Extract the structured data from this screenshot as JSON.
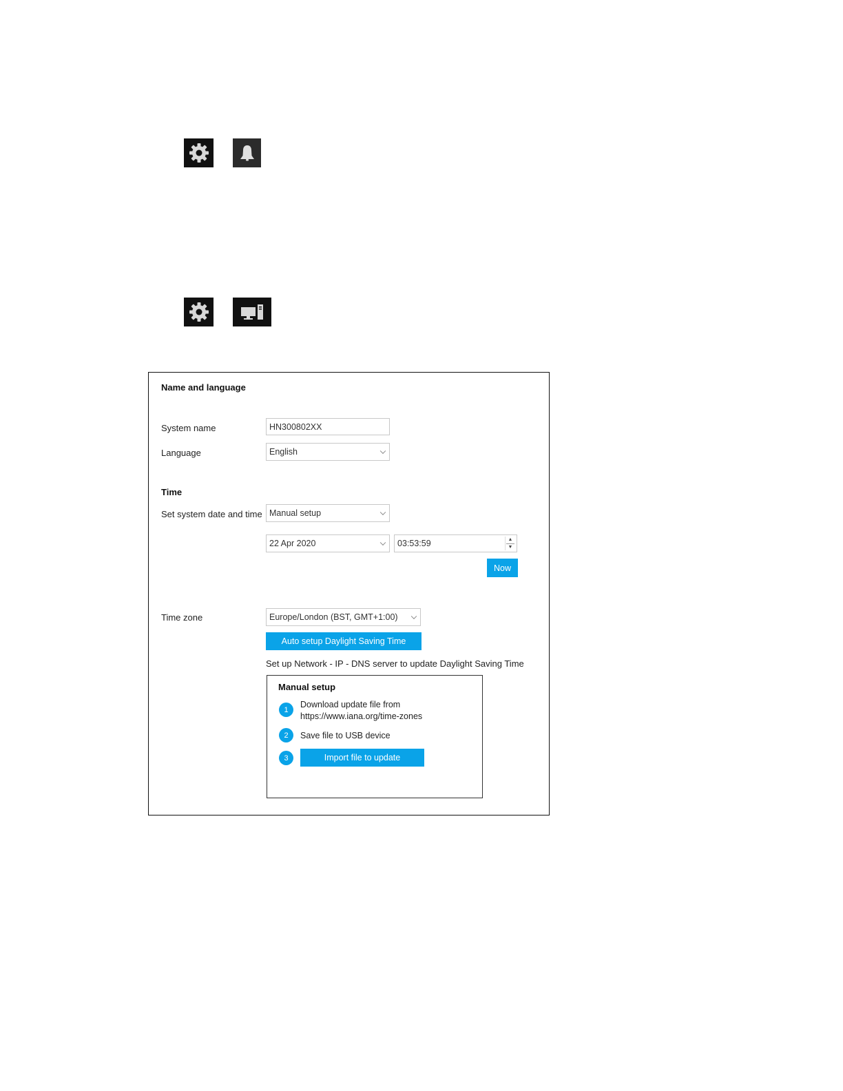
{
  "icons": {
    "first_pair": [
      "gear-icon",
      "bell-icon"
    ],
    "second_pair": [
      "gear-icon",
      "system-icon"
    ]
  },
  "name_language": {
    "heading": "Name and language",
    "system_name_label": "System name",
    "system_name_value": "HN300802XX",
    "language_label": "Language",
    "language_value": "English"
  },
  "time": {
    "heading": "Time",
    "set_label": "Set system date and time",
    "set_value": "Manual setup",
    "date_value": "22 Apr 2020",
    "time_value": "03:53:59",
    "now_label": "Now"
  },
  "timezone": {
    "label": "Time zone",
    "value": "Europe/London (BST, GMT+1:00)",
    "auto_dst_label": "Auto setup Daylight Saving Time",
    "dns_note": "Set up Network - IP - DNS server to update Daylight Saving Time"
  },
  "manual": {
    "heading": "Manual setup",
    "steps": [
      {
        "num": "1",
        "text_line1": "Download update file from",
        "text_line2": "https://www.iana.org/time-zones"
      },
      {
        "num": "2",
        "text": "Save file to USB device"
      },
      {
        "num": "3",
        "button": "Import file to update"
      }
    ]
  },
  "colors": {
    "accent": "#0aa3e8",
    "icon_bg": "#111111"
  }
}
